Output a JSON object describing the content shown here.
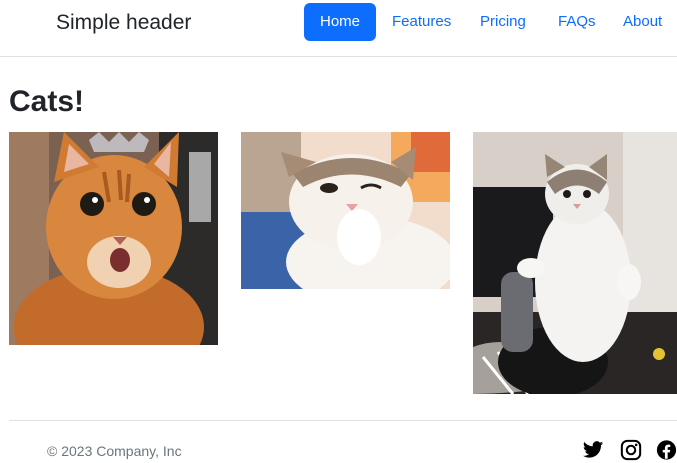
{
  "header": {
    "brand": "Simple header",
    "nav": [
      {
        "label": "Home",
        "active": true
      },
      {
        "label": "Features",
        "active": false
      },
      {
        "label": "Pricing",
        "active": false
      },
      {
        "label": "FAQs",
        "active": false
      },
      {
        "label": "About",
        "active": false
      }
    ]
  },
  "main": {
    "heading": "Cats!",
    "images": [
      {
        "subject": "orange tabby cat surprised"
      },
      {
        "subject": "white and tabby cat winking with paw on chin"
      },
      {
        "subject": "white and gray cat standing upright"
      }
    ]
  },
  "footer": {
    "copyright": "© 2023 Company, Inc",
    "social_icons": [
      "twitter-icon",
      "instagram-icon",
      "facebook-icon"
    ]
  },
  "colors": {
    "primary": "#0d6efd",
    "text": "#212529",
    "muted": "#6c757d",
    "border": "#dee2e6"
  }
}
